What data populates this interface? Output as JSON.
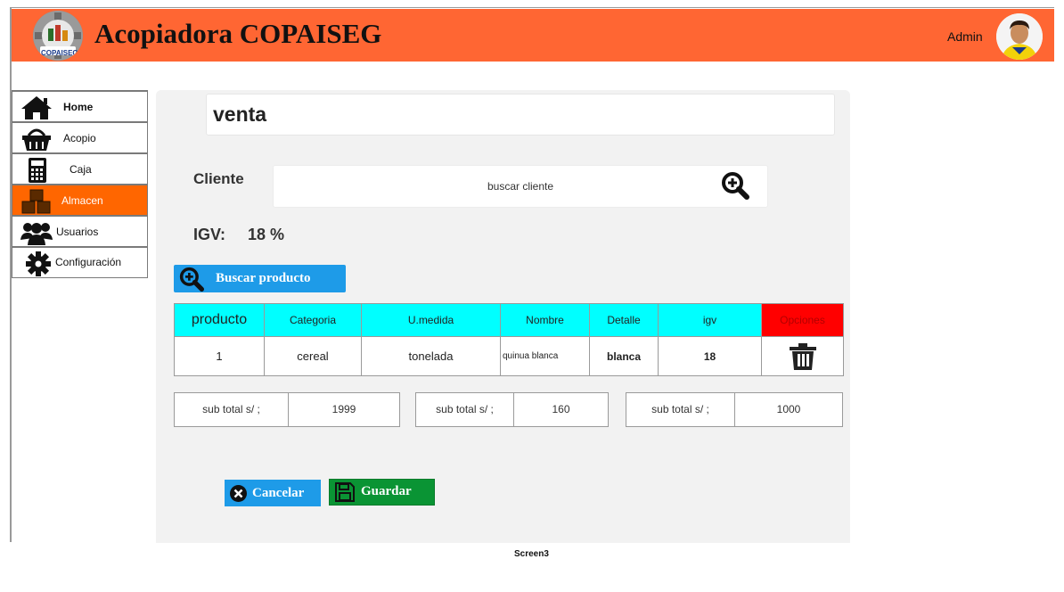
{
  "header": {
    "app_title": "Acopiadora COPAISEG",
    "logo_text": "COPAISEG",
    "user_label": "Admin",
    "background": "#ff6633"
  },
  "sidebar": {
    "items": [
      {
        "label": "Home",
        "icon": "home-icon",
        "active": false
      },
      {
        "label": "Acopio",
        "icon": "basket-icon",
        "active": false
      },
      {
        "label": "Caja",
        "icon": "calculator-icon",
        "active": false
      },
      {
        "label": "Almacen",
        "icon": "boxes-icon",
        "active": true
      },
      {
        "label": "Usuarios",
        "icon": "users-icon",
        "active": false
      },
      {
        "label": "Configuración",
        "icon": "gear-icon",
        "active": false
      }
    ],
    "active_color": "#ff6600"
  },
  "main": {
    "title": "venta",
    "cliente_label": "Cliente",
    "cliente_placeholder": "buscar cliente",
    "igv_label": "IGV:",
    "igv_value": "18 %",
    "buscar_producto_label": "Buscar producto",
    "table": {
      "headers": [
        "producto",
        "Categoria",
        "U.medida",
        "Nombre",
        "Detalle",
        "igv",
        "Opciones"
      ],
      "rows": [
        {
          "producto": "1",
          "categoria": "cereal",
          "umedida": "tonelada",
          "nombre": "quinua blanca",
          "detalle": "blanca",
          "igv": "18",
          "opcion_icon": "trash-icon"
        }
      ],
      "header_color": "#00ffff",
      "opciones_color": "#ff0000"
    },
    "subtotals": [
      {
        "label": "sub total s/ ;",
        "value": "1999"
      },
      {
        "label": "sub total s/ ;",
        "value": "160"
      },
      {
        "label": "sub total s/ ;",
        "value": "1000"
      }
    ],
    "cancel_label": "Cancelar",
    "save_label": "Guardar",
    "cancel_color": "#1e9be8",
    "save_color": "#0a9434"
  },
  "footer": {
    "screen_label": "Screen3"
  }
}
